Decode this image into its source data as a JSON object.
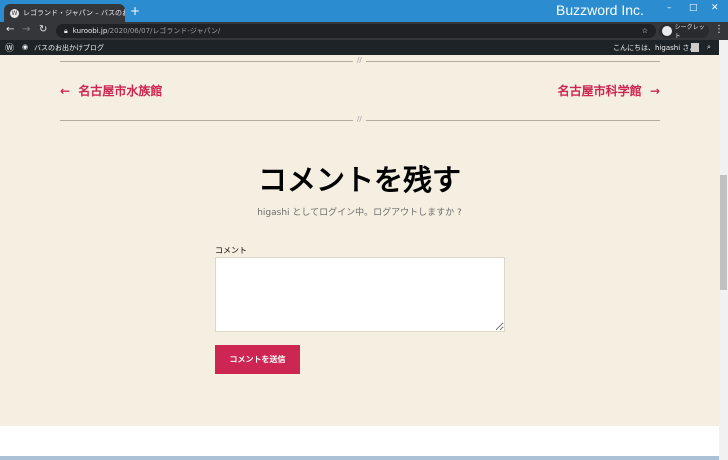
{
  "browser": {
    "tab_title": "レゴランド・ジャパン – バスのお出かけブ",
    "brand": "Buzzword Inc.",
    "url_domain": "kuroobi.jp",
    "url_path": "/2020/06/07/レゴランド-ジャパン/",
    "incognito_label": "シークレット",
    "accent": "#2b8dd0"
  },
  "adminbar": {
    "site_name": "バスのお出かけブログ",
    "greeting": "こんにちは、higashi さん"
  },
  "post_nav": {
    "separator": "//",
    "prev": "名古屋市水族館",
    "prev_arrow": "←",
    "next": "名古屋市科学館",
    "next_arrow": "→",
    "link_color": "#cd2653"
  },
  "comments": {
    "title": "コメントを残す",
    "logged_in": "higashi としてログイン中。ログアウトしますか ?",
    "field_label": "コメント",
    "field_value": "",
    "submit_label": "コメントを送信"
  }
}
